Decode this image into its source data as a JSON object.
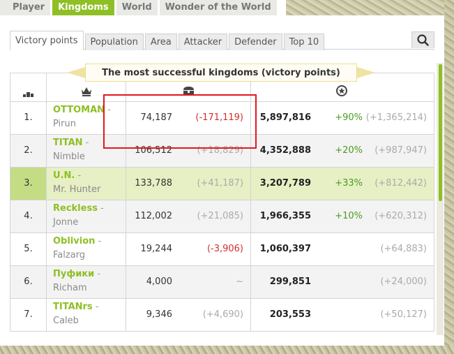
{
  "top_tabs": [
    "Player",
    "Kingdoms",
    "World",
    "Wonder of the World"
  ],
  "sub_tabs": [
    "Victory points",
    "Population",
    "Area",
    "Attacker",
    "Defender",
    "Top 10"
  ],
  "table_title": "The most successful kingdoms (victory points)",
  "header_icons": [
    "rank-icon",
    "crown-icon",
    "treasure-chest-icon",
    "victory-points-icon"
  ],
  "accent_color": "#8ebf24",
  "highlight_color": "#e6f0c4",
  "rows": [
    {
      "rank": "1.",
      "kingdom": "OTTOMAN",
      "leader": "Pirun",
      "treasures": "74,187",
      "treasures_change": "(-171,119)",
      "victory_points": "5,897,816",
      "vp_percent": "+90%",
      "vp_change": "(+1,365,214)"
    },
    {
      "rank": "2.",
      "kingdom": "TITAN",
      "leader": "Nimble",
      "treasures": "106,512",
      "treasures_change": "(+18,829)",
      "victory_points": "4,352,888",
      "vp_percent": "+20%",
      "vp_change": "(+987,947)"
    },
    {
      "rank": "3.",
      "kingdom": "U.N.",
      "leader": "Mr. Hunter",
      "treasures": "133,788",
      "treasures_change": "(+41,187)",
      "victory_points": "3,207,789",
      "vp_percent": "+33%",
      "vp_change": "(+812,442)"
    },
    {
      "rank": "4.",
      "kingdom": "Reckless",
      "leader": "Jonne",
      "treasures": "112,002",
      "treasures_change": "(+21,085)",
      "victory_points": "1,966,355",
      "vp_percent": "+10%",
      "vp_change": "(+620,312)"
    },
    {
      "rank": "5.",
      "kingdom": "Oblivion",
      "leader": "Falzarg",
      "treasures": "19,244",
      "treasures_change": "(-3,906)",
      "victory_points": "1,060,397",
      "vp_percent": "",
      "vp_change": "(+64,883)"
    },
    {
      "rank": "6.",
      "kingdom": "Пуфики",
      "leader": "Richam",
      "treasures": "4,000",
      "treasures_change": "~",
      "victory_points": "299,851",
      "vp_percent": "",
      "vp_change": "(+24,000)"
    },
    {
      "rank": "7.",
      "kingdom": "TITANrs",
      "leader": "Caleb",
      "treasures": "9,346",
      "treasures_change": "(+4,690)",
      "victory_points": "203,553",
      "vp_percent": "",
      "vp_change": "(+50,127)"
    }
  ]
}
